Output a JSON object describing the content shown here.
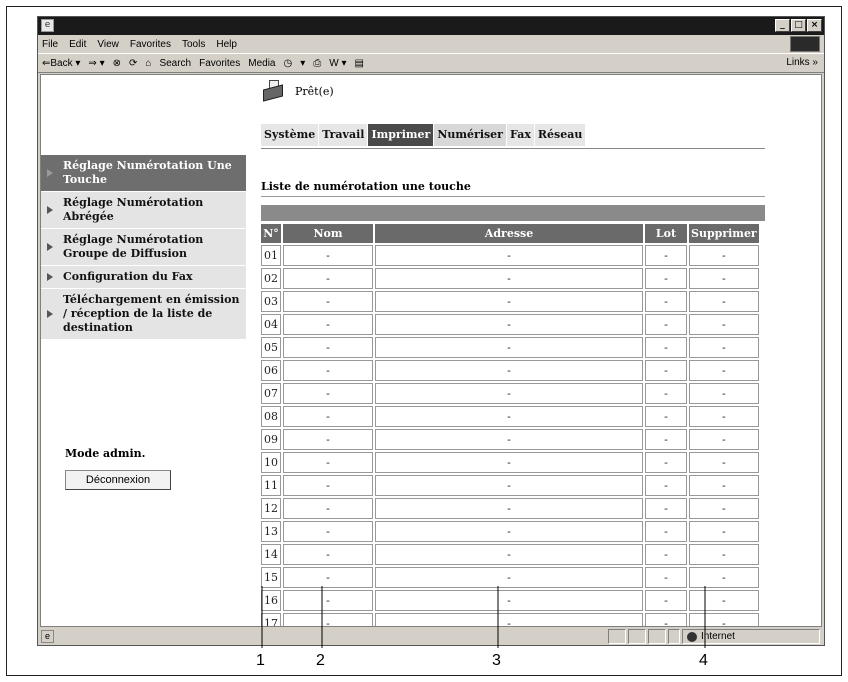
{
  "browser": {
    "menu": [
      "File",
      "Edit",
      "View",
      "Favorites",
      "Tools",
      "Help"
    ],
    "toolbar": [
      "⇐Back ▾",
      "⇒ ▾",
      "⊗",
      "⟳",
      "⌂",
      "Search",
      "Favorites",
      "Media",
      "◷",
      "▾",
      "⎙",
      "W ▾",
      "▤"
    ],
    "links_label": "Links »",
    "status_zone": "Internet"
  },
  "page": {
    "status": "Prêt(e)",
    "tabs": [
      {
        "label": "Système",
        "style": "light"
      },
      {
        "label": "Travail",
        "style": "light"
      },
      {
        "label": "Imprimer",
        "style": "active"
      },
      {
        "label": "Numériser",
        "style": "mid"
      },
      {
        "label": "Fax",
        "style": "light"
      },
      {
        "label": "Réseau",
        "style": "light"
      }
    ],
    "sidebar": [
      {
        "label": "Réglage Numérotation Une Touche",
        "active": true
      },
      {
        "label": "Réglage Numérotation Abrégée",
        "active": false
      },
      {
        "label": "Réglage Numérotation Groupe de Diffusion",
        "active": false
      },
      {
        "label": "Configuration du Fax",
        "active": false
      },
      {
        "label": "Téléchargement en émission / réception de la liste de destination",
        "active": false
      }
    ],
    "admin_label": "Mode admin.",
    "logout_label": "Déconnexion",
    "list_title": "Liste de numérotation une touche",
    "table": {
      "headers": [
        "N°",
        "Nom",
        "Adresse",
        "Lot",
        "Supprimer"
      ],
      "rows": [
        [
          "01",
          "-",
          "-",
          "-",
          "-"
        ],
        [
          "02",
          "-",
          "-",
          "-",
          "-"
        ],
        [
          "03",
          "-",
          "-",
          "-",
          "-"
        ],
        [
          "04",
          "-",
          "-",
          "-",
          "-"
        ],
        [
          "05",
          "-",
          "-",
          "-",
          "-"
        ],
        [
          "06",
          "-",
          "-",
          "-",
          "-"
        ],
        [
          "07",
          "-",
          "-",
          "-",
          "-"
        ],
        [
          "08",
          "-",
          "-",
          "-",
          "-"
        ],
        [
          "09",
          "-",
          "-",
          "-",
          "-"
        ],
        [
          "10",
          "-",
          "-",
          "-",
          "-"
        ],
        [
          "11",
          "-",
          "-",
          "-",
          "-"
        ],
        [
          "12",
          "-",
          "-",
          "-",
          "-"
        ],
        [
          "13",
          "-",
          "-",
          "-",
          "-"
        ],
        [
          "14",
          "-",
          "-",
          "-",
          "-"
        ],
        [
          "15",
          "-",
          "-",
          "-",
          "-"
        ],
        [
          "16",
          "-",
          "-",
          "-",
          "-"
        ],
        [
          "17",
          "-",
          "-",
          "-",
          "-"
        ]
      ]
    }
  },
  "callouts": [
    "1",
    "2",
    "3",
    "4"
  ]
}
